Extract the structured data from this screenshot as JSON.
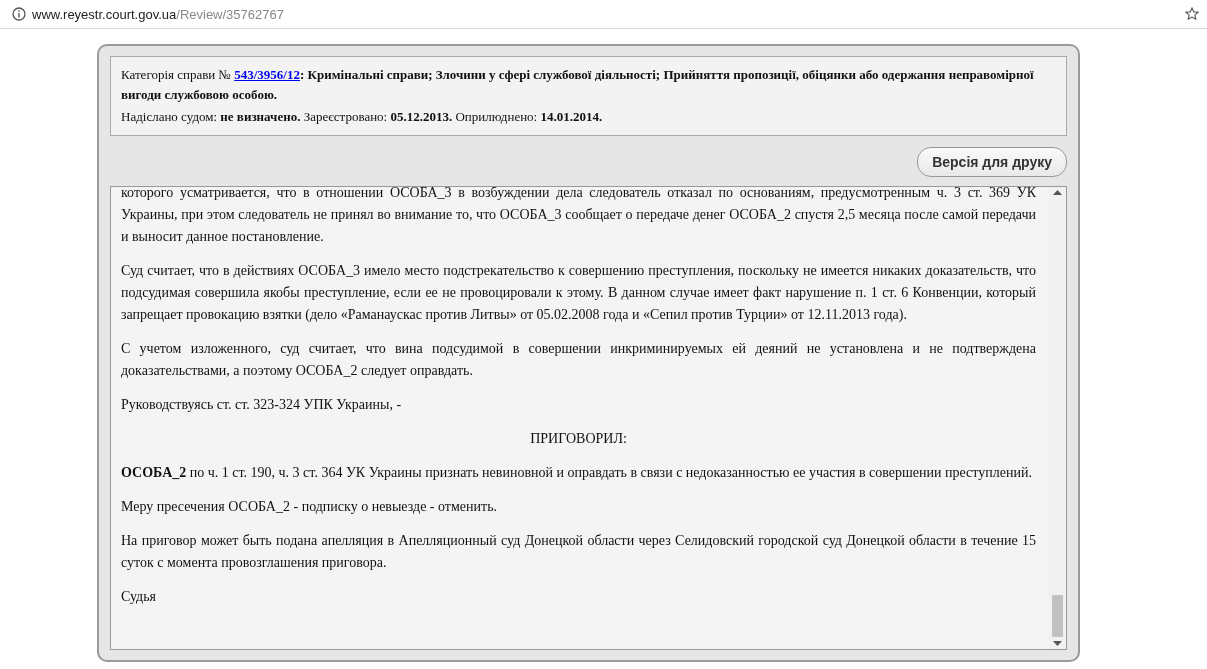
{
  "address_bar": {
    "domain": "www.reyestr.court.gov.ua",
    "path": "/Review/35762767"
  },
  "header": {
    "category_prefix": "Категорія справи №",
    "case_number": "543/3956/12",
    "category_text": "**: Кримінальні справи; Злочини у сфері службової діяльності; Прийняття пропозиції, обіцянки або одержання неправомірної вигоди службовою особою.**",
    "meta": "Надіслано судом: **не визначено.** Зареєстровано: **05.12.2013.** Оприлюднено: **14.01.2014.**"
  },
  "print_button": "Версія для друку",
  "document": [
    {
      "kind": "text",
      "text": "которого усматривается, что в отношении ОСОБА_3 в возбуждении дела следователь отказал по основаниям, предусмотренным ч. 3 ст. 369 УК Украины, при этом следователь не принял во внимание то, что ОСОБА_3 сообщает о передаче денег ОСОБА_2 спустя 2,5 месяца после самой передачи и выносит данное постановление."
    },
    {
      "kind": "text",
      "text": "Суд считает, что в действиях ОСОБА_3 имело место подстрекательство к совершению преступления, поскольку не имеется никаких доказательств, что подсудимая совершила якобы преступление, если ее не провоцировали к этому. В данном случае имеет факт нарушение п. 1 ст. 6 Конвенции, который запрещает провокацию взятки (дело «Раманаускас против Литвы» от 05.02.2008 года и «Сепил против Турции» от 12.11.2013 года)."
    },
    {
      "kind": "text",
      "text": "С учетом изложенного, суд считает, что вина подсудимой в совершении инкриминируемых ей деяний не установлена и не подтверждена доказательствами, а поэтому ОСОБА_2 следует оправдать."
    },
    {
      "kind": "text",
      "text": "Руководствуясь ст. ст. 323-324 УПК Украины, -"
    },
    {
      "kind": "heading",
      "text": "ПРИГОВОРИЛ:"
    },
    {
      "kind": "text",
      "text": "**ОСОБА_2**  по ч. 1 ст. 190, ч. 3 ст. 364 УК Украины признать невиновной и оправдать в связи с недоказанностью ее участия в совершении преступлений."
    },
    {
      "kind": "text",
      "text": "Меру пресечения ОСОБА_2 - подписку о невыезде - отменить."
    },
    {
      "kind": "text",
      "text": "На приговор может быть подана апелляция в Апелляционный суд Донецкой области через Селидовский городской суд Донецкой области в течение 15 суток с момента провозглашения приговора."
    },
    {
      "kind": "text",
      "text": "Судья"
    }
  ]
}
